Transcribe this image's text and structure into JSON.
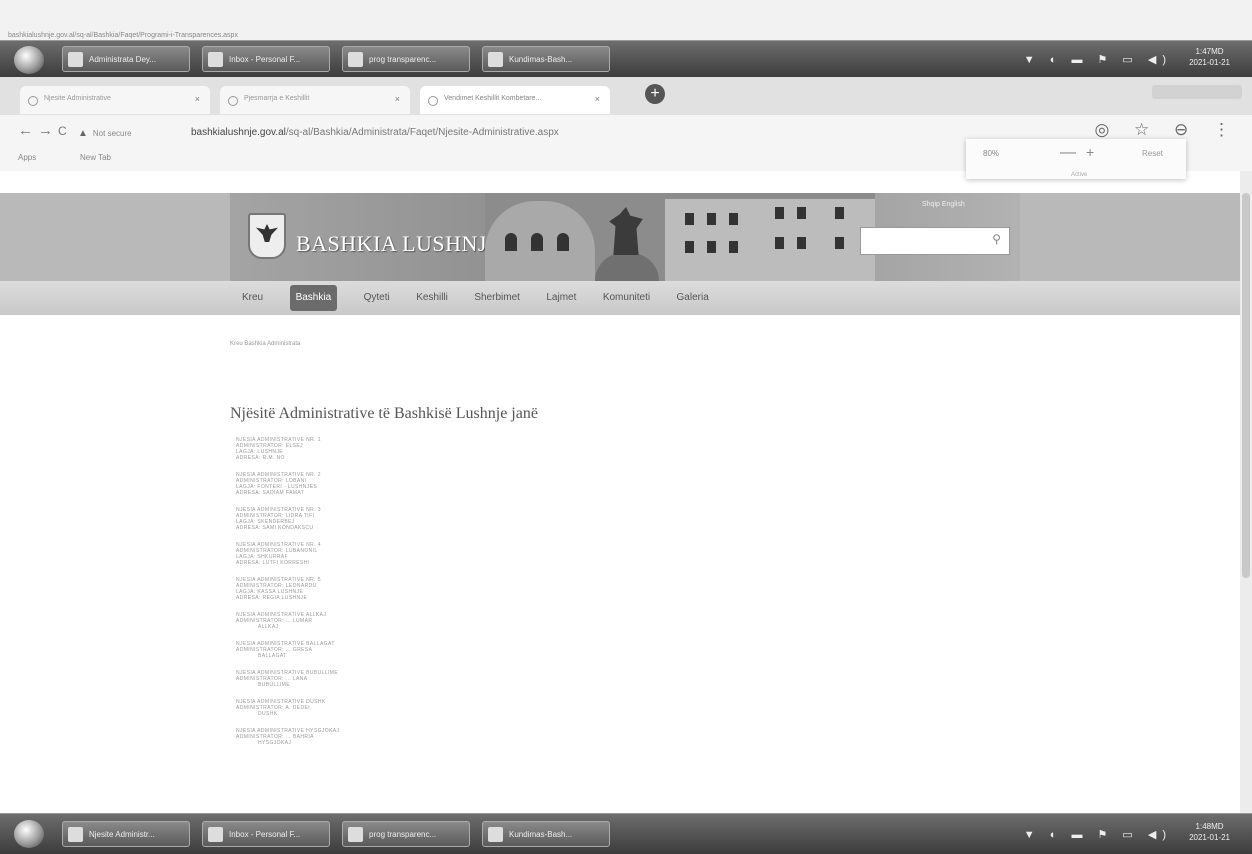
{
  "url_strip": "bashkialushnje.gov.al/sq-al/Bashkia/Faqet/Programi-i-Transparences.aspx",
  "taskbar_top": {
    "buttons": [
      {
        "label": "Administrata Dey..."
      },
      {
        "label": "Inbox - Personal F..."
      },
      {
        "label": "prog transparenc..."
      },
      {
        "label": "Kundimas-Bash..."
      }
    ],
    "tray": "▼ ◐ ▬ ⚑ ▭ ◀)",
    "time": "1:47MD",
    "date": "2021-01-21"
  },
  "tabs": [
    {
      "title": "Njesite Administrative",
      "close": "×"
    },
    {
      "title": "Pjesmarrja e Keshillit",
      "close": "×"
    },
    {
      "title": "Vendimet Keshillit Kombetare...",
      "close": "×"
    }
  ],
  "new_tab": "+",
  "toolbar": {
    "back": "←",
    "forward": "→",
    "reload": "C",
    "not_secure_icon": "▲",
    "not_secure": "Not secure",
    "host": "bashkialushnje.gov.al",
    "path": "/sq-al/Bashkia/Administrata/Faqet/Njesite-Administrative.aspx",
    "right_icons": "◎ ☆ ⊖ ⋮"
  },
  "bookmarks": [
    {
      "label": "Apps"
    },
    {
      "label": "New Tab"
    }
  ],
  "zoom_popup": {
    "percent": "80%",
    "minus": "—",
    "plus": "+",
    "reset": "Reset",
    "caption": "Active"
  },
  "site": {
    "title": "BASHKIA LUSHNJE",
    "lang_link": "Shqip  English",
    "search_placeholder": "",
    "search_icon": "⚲",
    "nav": [
      {
        "label": "Kreu"
      },
      {
        "label": "Bashkia"
      },
      {
        "label": "Qyteti"
      },
      {
        "label": "Keshilli"
      },
      {
        "label": "Sherbimet"
      },
      {
        "label": "Lajmet"
      },
      {
        "label": "Komuniteti"
      },
      {
        "label": "Galeria"
      }
    ],
    "breadcrumb": "Kreu  Bashkia  Administrata",
    "heading": "Njësitë Administrative të Bashkisë Lushnje janë",
    "units": [
      [
        "NJESIA ADMINISTRATIVE NR. 1",
        "ADMINISTRATOR: ELSEJ",
        "LAGJA: LUSHNJE",
        "ADRESA: R.M. NO"
      ],
      [
        "NJESIA ADMINISTRATIVE NR. 2",
        "ADMINISTRATOR: LOBANI",
        "LAGJA: FONTERI - LUSHNJES",
        "ADRESA: SADIAM FAMAT"
      ],
      [
        "NJESIA ADMINISTRATIVE NR. 3",
        "ADMINISTRATOR: LIDRA TIFI",
        "LAGJA: SKENDERBEJ",
        "ADRESA: SAMI KONDAKSCU"
      ],
      [
        "NJESIA ADMINISTRATIVE NR. 4",
        "ADMINISTRATOR: LUBANONIL",
        "LAGJA: SHKURRAF",
        "ADRESA: LUTFI KORRESHI"
      ],
      [
        "NJESIA ADMINISTRATIVE NR. 5",
        "ADMINISTRATOR: LEONARDU",
        "LAGJA: KASSA LUSHNJE",
        "ADRESA: REGIA LUSHNJE"
      ],
      [
        "NJESIA ADMINISTRATIVE ALLKAJ",
        "ADMINISTRATOR: ... LUMAR",
        "ALLKAJ"
      ],
      [
        "NJESIA ADMINISTRATIVE BALLAGAT",
        "ADMINISTRATOR: ... GRESA",
        "BALLAGAT"
      ],
      [
        "NJESIA ADMINISTRATIVE BUBULLIME",
        "ADMINISTRATOR: ... LANA",
        "BUBULLIME"
      ],
      [
        "NJESIA ADMINISTRATIVE DUSHK",
        "ADMINISTRATOR: A. DEDEI",
        "DUSHK"
      ],
      [
        "NJESIA ADMINISTRATIVE HYSGJOKAJ",
        "ADMINISTRATOR: ... BAHRIA",
        "HYSGJOKAJ"
      ]
    ]
  },
  "taskbar_bottom": {
    "buttons": [
      {
        "label": "Njesite Administr..."
      },
      {
        "label": "Inbox - Personal F..."
      },
      {
        "label": "prog transparenc..."
      },
      {
        "label": "Kundimas-Bash..."
      }
    ],
    "tray": "▼ ◐ ▬ ⚑ ▭ ◀)",
    "time": "1:48MD",
    "date": "2021-01-21"
  }
}
